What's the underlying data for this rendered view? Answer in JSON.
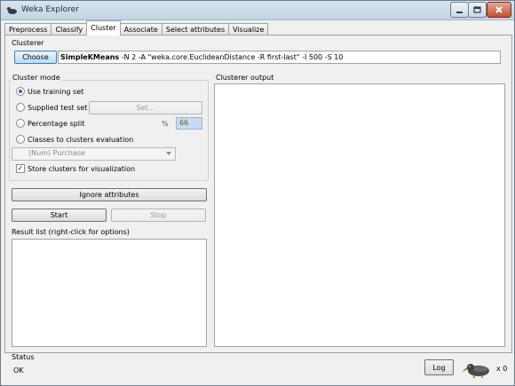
{
  "window": {
    "title": "Weka Explorer"
  },
  "tabs": [
    {
      "label": "Preprocess",
      "active": false
    },
    {
      "label": "Classify",
      "active": false
    },
    {
      "label": "Cluster",
      "active": true
    },
    {
      "label": "Associate",
      "active": false
    },
    {
      "label": "Select attributes",
      "active": false
    },
    {
      "label": "Visualize",
      "active": false
    }
  ],
  "clusterer": {
    "section_label": "Clusterer",
    "choose_label": "Choose",
    "name": "SimpleKMeans",
    "options": " -N 2 -A \"weka.core.EuclideanDistance -R first-last\" -I 500 -S 10"
  },
  "cluster_mode": {
    "section_label": "Cluster mode",
    "use_training_set": {
      "label": "Use training set",
      "selected": true
    },
    "supplied_test_set": {
      "label": "Supplied test set",
      "selected": false
    },
    "set_button_label": "Set...",
    "percentage_split": {
      "label": "Percentage split",
      "selected": false
    },
    "percent_symbol": "%",
    "percentage_value": "66",
    "classes_to_clusters": {
      "label": "Classes to clusters evaluation",
      "selected": false
    },
    "class_attribute": "(Num) Purchase",
    "store_clusters": {
      "label": "Store clusters for visualization",
      "checked": true
    }
  },
  "actions": {
    "ignore_attributes_label": "Ignore attributes",
    "start_label": "Start",
    "stop_label": "Stop"
  },
  "result_list": {
    "label": "Result list (right-click for options)"
  },
  "output": {
    "label": "Clusterer output"
  },
  "status": {
    "section_label": "Status",
    "text": "OK",
    "log_label": "Log",
    "task_count": "x 0"
  },
  "colors": {
    "selection_blue": "#2a6ab0",
    "field_blue": "#c8dcf0",
    "choose_blue": "#b9dcf2"
  }
}
